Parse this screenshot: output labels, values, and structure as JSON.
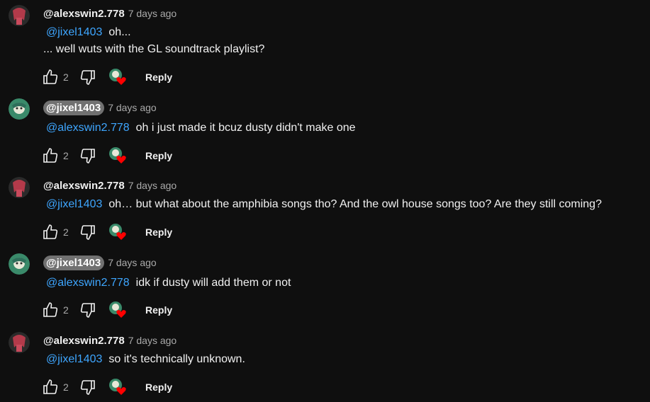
{
  "colors": {
    "background": "#0f0f0f",
    "mention": "#3ea6ff",
    "muted": "#aaaaaa",
    "heart": "#ff0000",
    "pill": "#717171"
  },
  "comments": [
    {
      "author": "@alexswin2.778",
      "time": "7 days ago",
      "mention": "@jixel1403",
      "text": "oh...",
      "extra_line": "... well wuts with the GL soundtrack playlist?",
      "likes": "2",
      "reply_label": "Reply"
    },
    {
      "author": "@jixel1403",
      "time": "7 days ago",
      "mention": "@alexswin2.778",
      "text": "oh i just made it bcuz dusty didn't make one",
      "likes": "2",
      "reply_label": "Reply"
    },
    {
      "author": "@alexswin2.778",
      "time": "7 days ago",
      "mention": "@jixel1403",
      "text": "oh… but what about the amphibia songs tho? And the owl house songs too? Are they still coming?",
      "likes": "2",
      "reply_label": "Reply"
    },
    {
      "author": "@jixel1403",
      "time": "7 days ago",
      "mention": "@alexswin2.778",
      "text": "idk if dusty will add them or not",
      "likes": "2",
      "reply_label": "Reply"
    },
    {
      "author": "@alexswin2.778",
      "time": "7 days ago",
      "mention": "@jixel1403",
      "text": "so it's technically unknown.",
      "likes": "2",
      "reply_label": "Reply"
    }
  ],
  "icons": [
    "like-icon",
    "dislike-icon",
    "creator-heart-icon",
    "avatar"
  ]
}
